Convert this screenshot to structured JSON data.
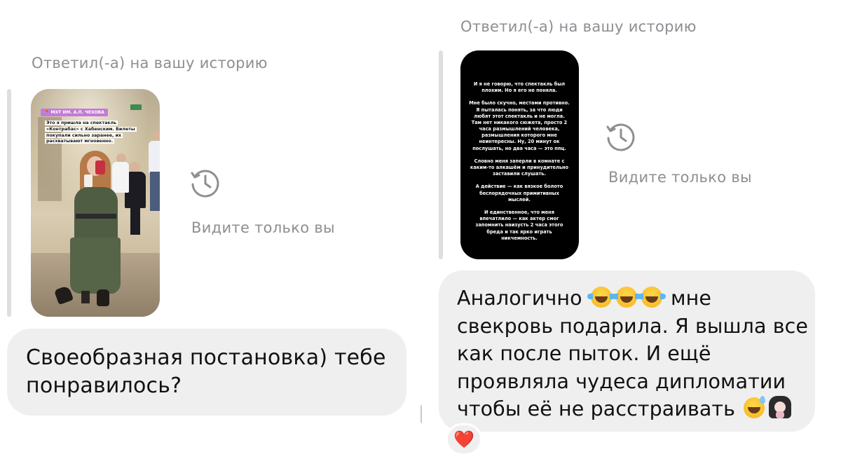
{
  "left_chat": {
    "reply_caption": "Ответил(-а) на вашу историю",
    "story": {
      "tag": "📍 МХТ ИМ. А.П. ЧЕХОВА",
      "overlay_text": "Это я пришла на спектакль «Контрабас» с Хабенским. Билеты покупали сильно заранее, их расхватывают мгновенно."
    },
    "only_you_label": "Видите только вы",
    "message": "Своеобразная постановка) тебе понравилось?"
  },
  "right_chat": {
    "reply_caption": "Ответил(-а) на вашу историю",
    "story": {
      "paragraphs": [
        "И я не говорю, что спектакль был плохим. Но я его не поняла.",
        "Мне было скучно, местами противно. Я пыталась понять, за что люди любят этот спектакль и не могла. Там нет никакого сюжета, просто 2 часа размышлений человека, размышления которого мне неинтересны. Ну, 20 минут ок послушать, но два часа — это ппц.",
        "Словно меня заперли в комнате с каким-то алкашём и принудительно заставили слушать.",
        "А действие — как вязкое болото беспорядочных примитивных мыслей.",
        "И единственное, что меня впечатлило — как актер смог запомнить наизусть 2 часа этого бреда и так ярко играть никчемность."
      ]
    },
    "only_you_label": "Видите только вы",
    "message_lines": {
      "l1": "Аналогично",
      "l1b": "мне",
      "l2": "свекровь подарила. Я вышла все",
      "l3": "как после пыток. И ещё",
      "l4": "проявляла чудеса дипломатии",
      "l5": "чтобы её не расстраивать"
    },
    "reaction": "❤️"
  },
  "icons": {
    "history": "history-icon",
    "emoji_tears": "face-with-tears-of-joy",
    "emoji_sweat": "grinning-face-with-sweat",
    "emoji_facepalm": "woman-facepalming",
    "reaction_heart": "red-heart"
  },
  "colors": {
    "caption_gray": "#8e8e93",
    "bubble_gray": "#efefef",
    "quote_bar": "#dedede"
  }
}
